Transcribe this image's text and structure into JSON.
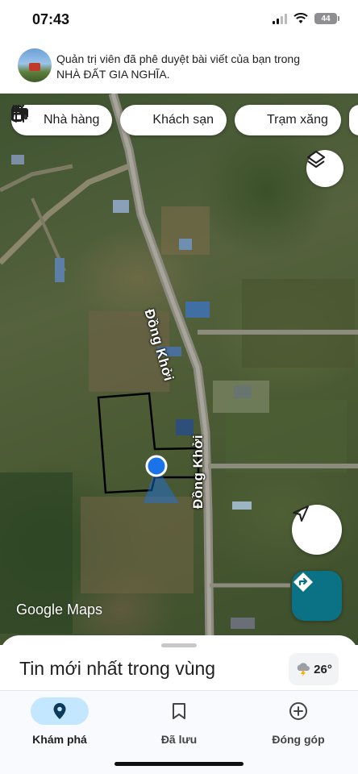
{
  "status_bar": {
    "time": "07:43",
    "battery": "44"
  },
  "notification": {
    "line1": "Quản trị viên đã phê duyệt bài viết của bạn trong",
    "line2": "NHÀ ĐẤT GIA NGHĨA."
  },
  "map": {
    "chips": [
      {
        "label": "Nhà hàng",
        "icon": "restaurant-icon"
      },
      {
        "label": "Khách sạn",
        "icon": "hotel-icon"
      },
      {
        "label": "Trạm xăng",
        "icon": "gas-station-icon"
      }
    ],
    "road_labels": [
      "Đồng Khởi",
      "Đồng Khởi"
    ],
    "attribution": "Google Maps",
    "colors": {
      "location_dot": "#1a73e8",
      "directions_button": "#0b7285",
      "parcel_outline": "#000000"
    }
  },
  "sheet": {
    "title": "Tin mới nhất trong vùng",
    "weather": "26°"
  },
  "nav": {
    "items": [
      {
        "label": "Khám phá",
        "icon": "location-pin-icon",
        "active": true
      },
      {
        "label": "Đã lưu",
        "icon": "bookmark-icon",
        "active": false
      },
      {
        "label": "Đóng góp",
        "icon": "add-circle-icon",
        "active": false
      }
    ]
  }
}
